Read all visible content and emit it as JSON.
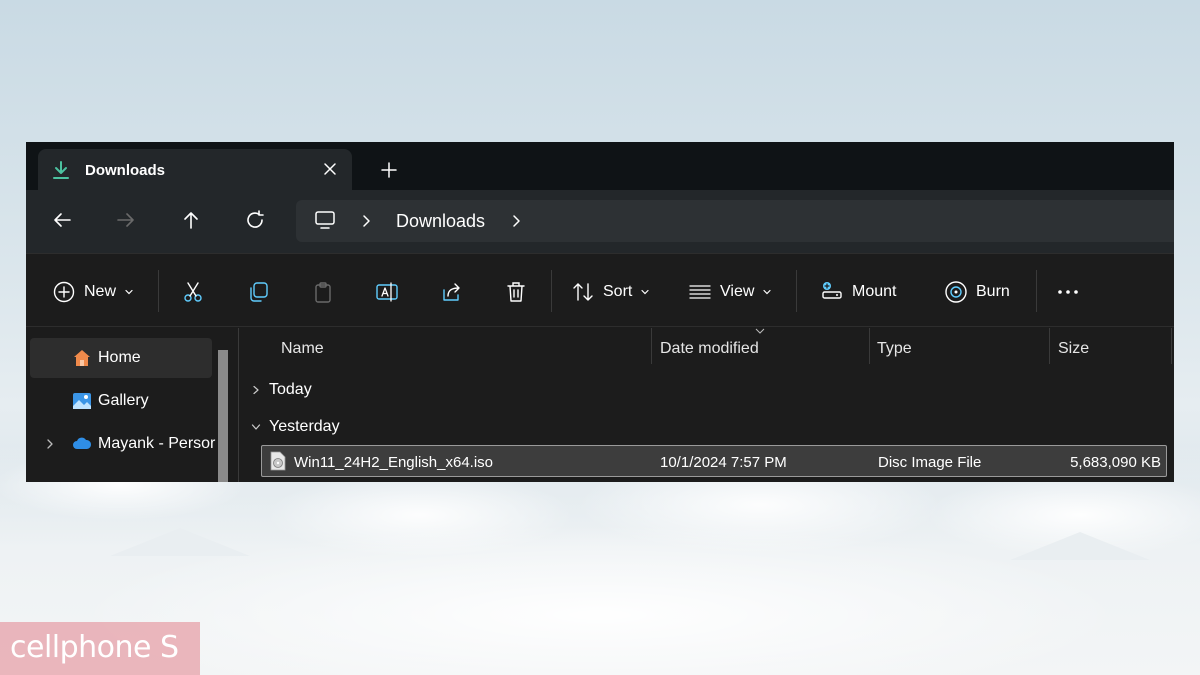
{
  "window": {
    "tab": {
      "title": "Downloads",
      "icon": "download-icon"
    },
    "address": {
      "crumb": "Downloads"
    },
    "toolbar": {
      "new_label": "New",
      "sort_label": "Sort",
      "view_label": "View",
      "mount_label": "Mount",
      "burn_label": "Burn"
    },
    "sidebar": {
      "items": [
        {
          "label": "Home",
          "icon": "home-icon",
          "selected": true
        },
        {
          "label": "Gallery",
          "icon": "gallery-icon"
        },
        {
          "label": "Mayank - Persor",
          "icon": "cloud-icon"
        }
      ]
    },
    "columns": [
      "Name",
      "Date modified",
      "Type",
      "Size"
    ],
    "groups": [
      "Today",
      "Yesterday"
    ],
    "files": [
      {
        "name": "Win11_24H2_English_x64.iso",
        "date": "10/1/2024 7:57 PM",
        "type": "Disc Image File",
        "size": "5,683,090 KB"
      }
    ]
  },
  "watermark": {
    "text": "cellphone S"
  },
  "colors": {
    "accent": "#4cc2a0",
    "window_bg": "#1c1c1c",
    "titlebar": "#0f1316",
    "selection": "#3d3d3d"
  }
}
